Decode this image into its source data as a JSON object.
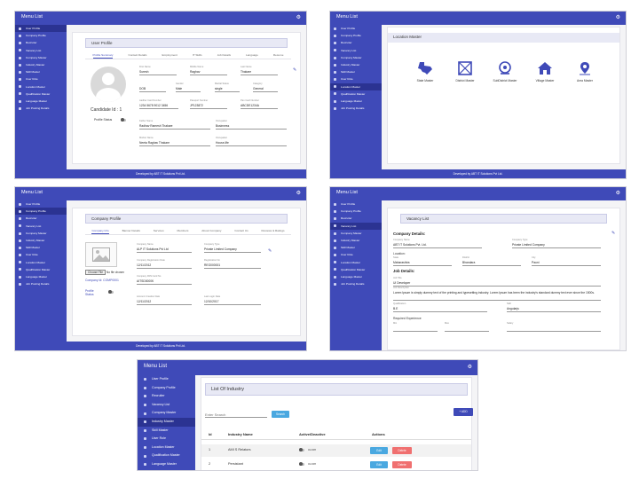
{
  "common": {
    "menu_title": "Menu List",
    "footer": "Developed by ABT IT Solutions Pvt Ltd.",
    "gear_glyph": "⚙",
    "edit_glyph": "✎"
  },
  "panel1": {
    "sidebar": [
      "User Profile",
      "Company Profile",
      "Recruiter",
      "Vacancy List",
      "Company Master",
      "Industry Master",
      "Skill Master",
      "User Role",
      "Location Master",
      "Qualification Master",
      "Language Master",
      "Job Posting Details"
    ],
    "active_index": 0,
    "page_title": "User Profile",
    "tabs": [
      "Profile Summary",
      "Contact Details",
      "Employment",
      "IT Skills",
      "Job Details",
      "Language",
      "Resume"
    ],
    "candidate_id": "Candidate Id : 1",
    "profile_status_label": "Profile Status",
    "fields": {
      "first_name_label": "First Name",
      "first_name": "Suresh",
      "middle_name_label": "Middle Name",
      "middle_name": "Raghav",
      "last_name_label": "Last Name",
      "last_name": "Thakare",
      "dob_label": "DOB",
      "gender_label": "Gender",
      "gender": "Male",
      "marital_label": "Marital Status",
      "marital": "single",
      "category_label": "Category",
      "category": "General",
      "aadhar_label": "Aadhar Card Number",
      "aadhar": "1234 5678 9012 3456",
      "passport_label": "Passport Number",
      "passport": "JP123872",
      "pan_label": "Pan Card Number",
      "pan": "ABCDE1234A",
      "father_label": "Father Name",
      "father": "Radhav Ramesh Thakare",
      "father_occ_label": "Occupation",
      "father_occ": "Businness",
      "mother_label": "Mother Name",
      "mother": "Neeta Raghav Thakare",
      "mother_occ_label": "Occupation",
      "mother_occ": "House-life"
    }
  },
  "panel2": {
    "sidebar": [
      "User Profile",
      "Company Profile",
      "Recruiter",
      "Vacancy List",
      "Company Master",
      "Industry Master",
      "Skill Master",
      "User Role",
      "Location Master",
      "Qualification Master",
      "Language Master",
      "Job Posting Details"
    ],
    "active_index": 8,
    "page_title": "Location Master",
    "items": [
      {
        "label": "State Master",
        "icon": "state-map-icon"
      },
      {
        "label": "District Master",
        "icon": "district-map-icon"
      },
      {
        "label": "SubDistrict Master",
        "icon": "subdistrict-icon"
      },
      {
        "label": "Village Master",
        "icon": "village-home-icon"
      },
      {
        "label": "Area Master",
        "icon": "area-pin-icon"
      }
    ]
  },
  "panel3": {
    "sidebar": [
      "User Profile",
      "Company Profile",
      "Recruiter",
      "Vacancy List",
      "Company Master",
      "Industry Master",
      "Skill Master",
      "User Role",
      "Location Master",
      "Qualification Master",
      "Language Master",
      "Job Posting Details"
    ],
    "active_index": 1,
    "page_title": "Company Profile",
    "tabs": [
      "Company Info",
      "Banner Details",
      "Services",
      "Members",
      "About Company",
      "Contact Us",
      "Reviews & Ratings"
    ],
    "choose_file": "Choose File",
    "no_file": "No file chosen",
    "company_id": "Company Id: COMP0001",
    "profile_status_label": "Profile Status",
    "fields": {
      "company_name_label": "Company Name",
      "company_name": "ALP IT Solutions Pvt Ltd",
      "company_type_label": "Company Type",
      "company_type": "Private Limited Company",
      "reg_date_label": "Company Registration Date",
      "reg_date": "12/11/2012",
      "reg_no_label": "Registration No",
      "reg_no": "REG000001",
      "pan_label": "Company PAN Card No",
      "pan": "AITSD0000K",
      "created_label": "Account Creation Date",
      "created": "12/11/2012",
      "last_login_label": "Last Login Date",
      "last_login": "12/10/2017"
    }
  },
  "panel4": {
    "sidebar": [
      "User Profile",
      "Company Profile",
      "Recruiter",
      "Vacancy List",
      "Company Master",
      "Industry Master",
      "Skill Master",
      "User Role",
      "Location Master",
      "Qualification Master",
      "Language Master",
      "Job Posting Details"
    ],
    "active_index": 3,
    "page_title": "Vacancy List",
    "company_details": "Company Details:",
    "job_details": "Job Details:",
    "location_label": "Location:",
    "required_exp": "Required Experience",
    "fields": {
      "company_name_label": "Company Name",
      "company_name": "ABT IT Solutions Pvt. Ltd.",
      "company_type_label": "Company Type",
      "company_type": "Private Limited Company",
      "state_label": "State",
      "state": "Maharashtra",
      "district_label": "District",
      "district": "Bhandara",
      "city_label": "City",
      "city": "Pauni",
      "job_title_label": "Job Title",
      "job_title": "UI Developer",
      "job_desc_label": "Job Description",
      "job_desc": "Lorem Ipsum is simply dummy text of the printing and typesetting industry. Lorem Ipsum has been the industry's standard dummy text ever since the 1500s.",
      "qualification_label": "Qualification",
      "qualification": "B.E",
      "skill_label": "Skill",
      "skill": "Angularjs",
      "exp_min_label": "Min",
      "exp_max_label": "Max",
      "salary_label": "Salary"
    }
  },
  "panel5": {
    "sidebar": [
      "User Profile",
      "Company Profile",
      "Recruiter",
      "Vacancy List",
      "Company Master",
      "Industry Master",
      "Skill Master",
      "User Role",
      "Location Master",
      "Qualification Master",
      "Language Master"
    ],
    "active_index": 5,
    "page_title": "List Of Industry",
    "search_placeholder": "Enter Search",
    "search_btn": "Search",
    "add_btn": "ADD",
    "headers": [
      "Id",
      "Industry Name",
      "Active/Deactive",
      "Actions"
    ],
    "rows": [
      {
        "id": "1",
        "name": "AMI S Relators",
        "status": "On/Off",
        "edit": "Edit",
        "delete": "Delete"
      },
      {
        "id": "2",
        "name": "Persistant",
        "status": "On/Off",
        "edit": "Edit",
        "delete": "Delete"
      }
    ]
  }
}
